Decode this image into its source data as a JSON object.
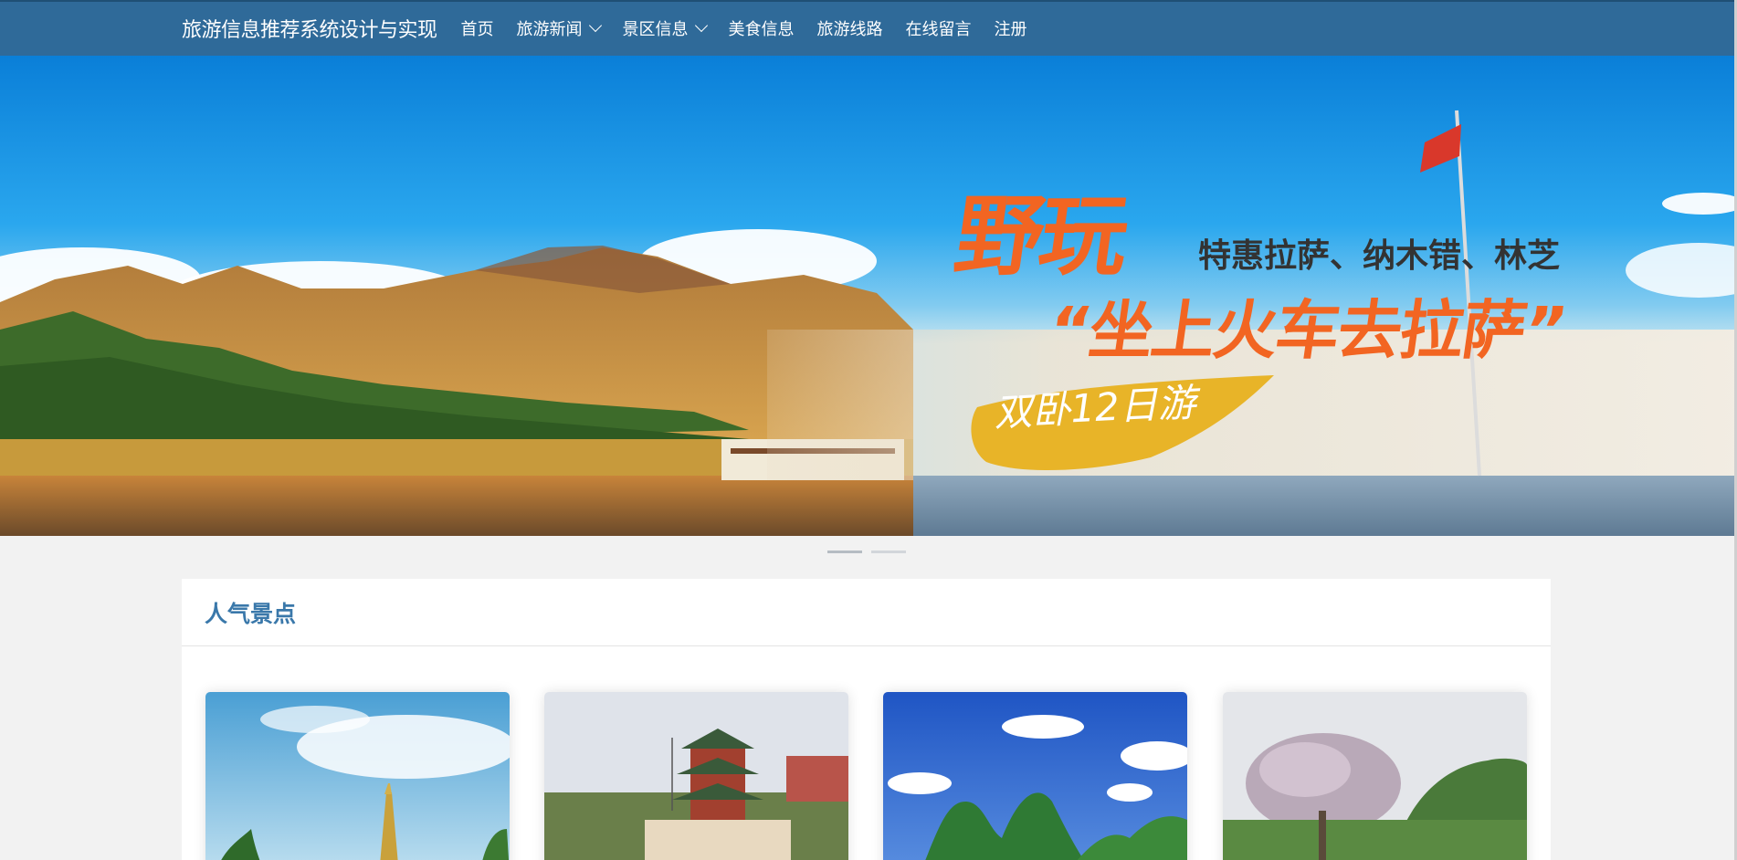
{
  "navbar": {
    "brand": "旅游信息推荐系统设计与实现",
    "items": [
      {
        "label": "首页",
        "has_dropdown": false
      },
      {
        "label": "旅游新闻",
        "has_dropdown": true
      },
      {
        "label": "景区信息",
        "has_dropdown": true
      },
      {
        "label": "美食信息",
        "has_dropdown": false
      },
      {
        "label": "旅游线路",
        "has_dropdown": false
      },
      {
        "label": "在线留言",
        "has_dropdown": false
      },
      {
        "label": "注册",
        "has_dropdown": false
      }
    ],
    "background": "#2f6a99"
  },
  "banner": {
    "headline": "野玩",
    "subline": "特惠拉萨、纳木错、林芝",
    "slogan": "“坐上火车去拉萨”",
    "tag": "双卧12日游",
    "accent": "#f26522",
    "slides": 2,
    "active_slide": 1
  },
  "section": {
    "title": "人气景点",
    "title_color": "#3a78aa"
  },
  "cards": [
    {
      "image": "pagoda-sky-photo"
    },
    {
      "image": "temple-pavilion-photo"
    },
    {
      "image": "karst-mountains-photo"
    },
    {
      "image": "blossom-tree-photo"
    }
  ]
}
